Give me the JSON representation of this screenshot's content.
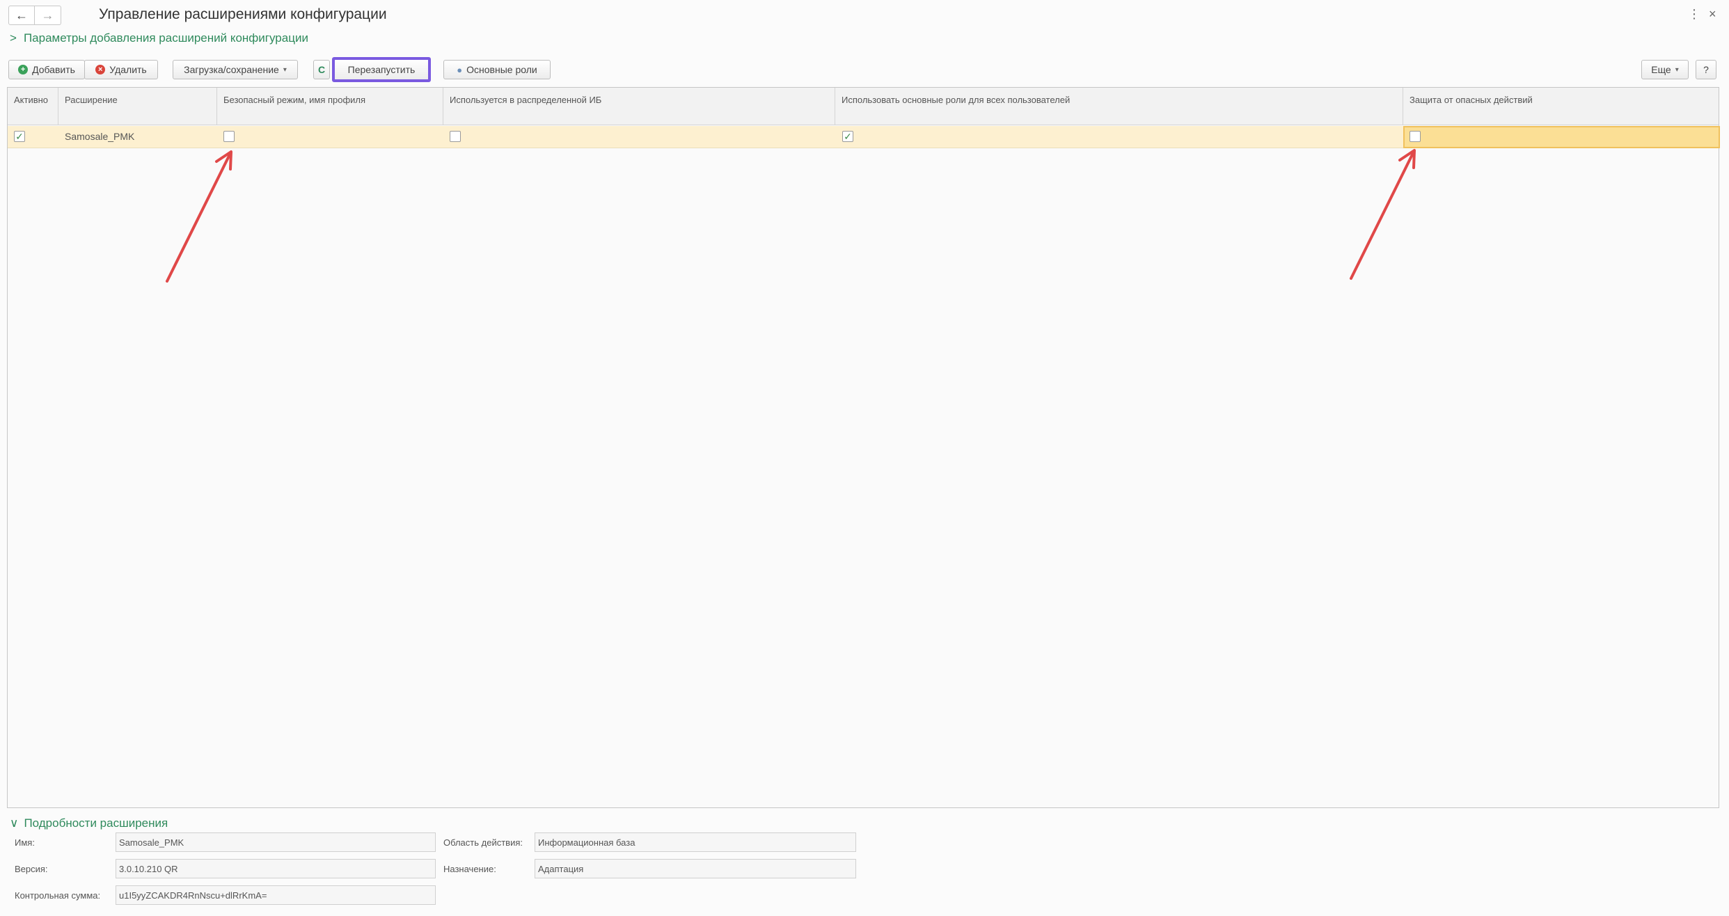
{
  "window": {
    "title": "Управление расширениями конфигурации",
    "back_icon": "←",
    "forward_icon": "→",
    "menu_icon": "⋮",
    "close_icon": "×"
  },
  "params_group": {
    "chevron": ">",
    "label": "Параметры добавления расширений конфигурации"
  },
  "toolbar": {
    "add_label": "Добавить",
    "delete_label": "Удалить",
    "load_save_label": "Загрузка/сохранение",
    "refresh_icon": "C",
    "restart_label": "Перезапустить",
    "main_roles_label": "Основные роли",
    "more_label": "Еще",
    "help_label": "?"
  },
  "grid": {
    "columns": [
      "Активно",
      "Расширение",
      "Безопасный режим, имя профиля",
      "Используется в распределенной ИБ",
      "Использовать основные роли для всех пользователей",
      "Защита от опасных действий"
    ],
    "rows": [
      {
        "active": true,
        "extension": "Samosale_PMK",
        "safe_mode": false,
        "distributed": false,
        "use_main_roles": true,
        "protection": false
      }
    ]
  },
  "details": {
    "chevron": "∨",
    "header": "Подробности расширения",
    "name_label": "Имя:",
    "name_value": "Samosale_PMK",
    "version_label": "Версия:",
    "version_value": "3.0.10.210 QR",
    "checksum_label": "Контрольная сумма:",
    "checksum_value": "u1I5yyZCAKDR4RnNscu+dlRrKmA=",
    "scope_label": "Область действия:",
    "scope_value": "Информационная база",
    "purpose_label": "Назначение:",
    "purpose_value": "Адаптация"
  },
  "colors": {
    "accent_green": "#2f8a5c",
    "selected_row": "#fdf0d0",
    "active_cell": "#fbdf95",
    "highlight_frame": "#7a5ae0",
    "annotation_arrow": "#e04848"
  }
}
